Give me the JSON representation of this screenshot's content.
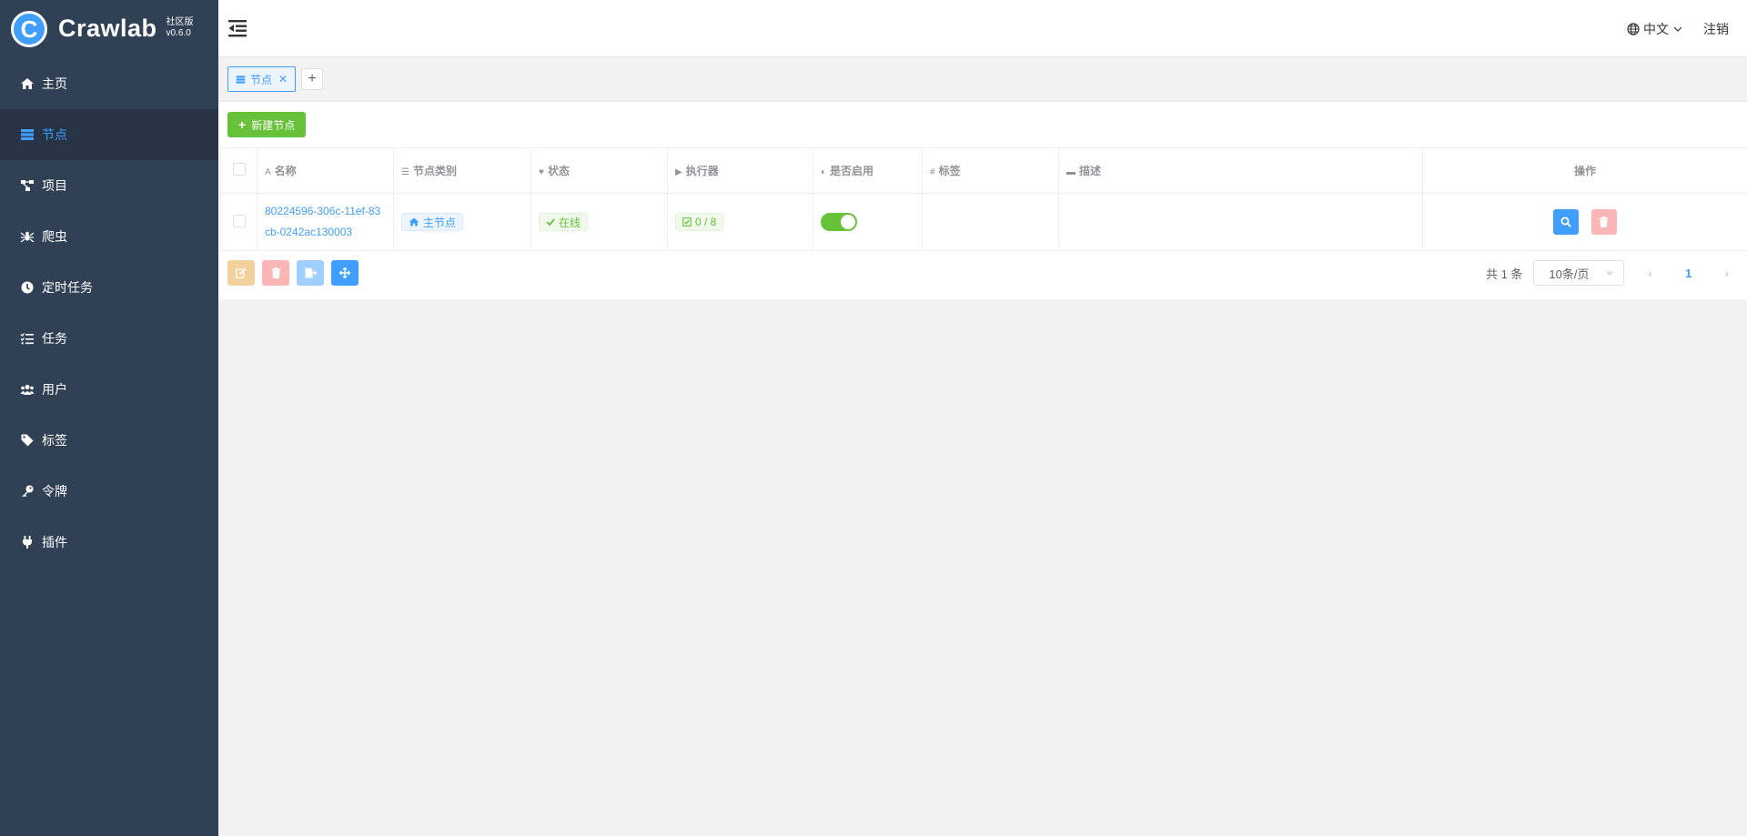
{
  "app": {
    "name": "Crawlab",
    "edition": "社区版",
    "version": "v0.6.0"
  },
  "sidebar": {
    "items": [
      {
        "label": "主页",
        "icon": "home-icon"
      },
      {
        "label": "节点",
        "icon": "server-icon",
        "active": true
      },
      {
        "label": "项目",
        "icon": "project-diagram-icon"
      },
      {
        "label": "爬虫",
        "icon": "spider-icon"
      },
      {
        "label": "定时任务",
        "icon": "clock-icon"
      },
      {
        "label": "任务",
        "icon": "tasks-icon"
      },
      {
        "label": "用户",
        "icon": "users-icon"
      },
      {
        "label": "标签",
        "icon": "tag-icon"
      },
      {
        "label": "令牌",
        "icon": "key-icon"
      },
      {
        "label": "插件",
        "icon": "plug-icon"
      }
    ]
  },
  "header": {
    "language": "中文",
    "logout": "注销"
  },
  "tabs": [
    {
      "label": "节点"
    }
  ],
  "toolbar": {
    "new_node": "新建节点"
  },
  "table": {
    "columns": [
      "名称",
      "节点类别",
      "状态",
      "执行器",
      "是否启用",
      "标签",
      "描述",
      "操作"
    ],
    "rows": [
      {
        "name_line1": "80224596-306c-11ef-83",
        "name_line2": "cb-0242ac130003",
        "type": "主节点",
        "status": "在线",
        "executors": "0 / 8",
        "enabled": true,
        "tags": "",
        "description": ""
      }
    ]
  },
  "pagination": {
    "total": "共 1 条",
    "page_size": "10条/页",
    "current_page": "1"
  },
  "colors": {
    "sidebar_bg": "#304156",
    "accent": "#409eff",
    "success": "#67c23a"
  }
}
